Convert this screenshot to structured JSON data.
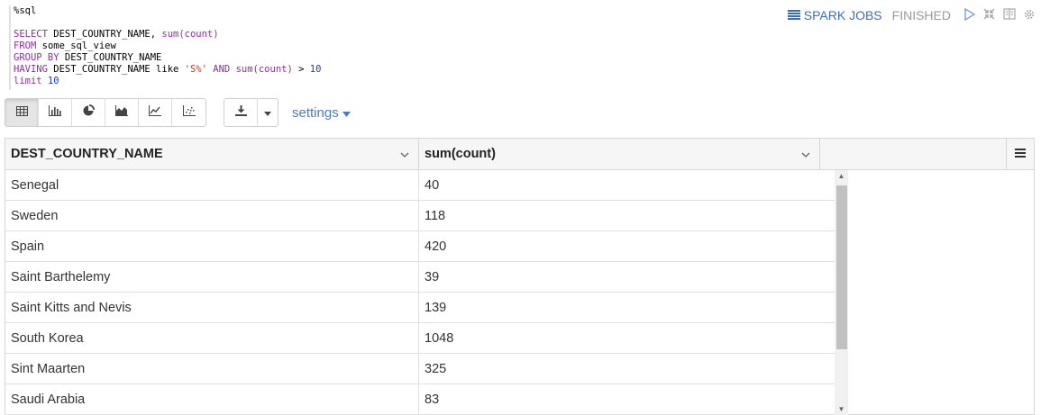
{
  "code": {
    "magic": "%sql",
    "l1_kw": "SELECT",
    "l1_rest": " DEST_COUNTRY_NAME, ",
    "l1_fn": "sum(count)",
    "l2_kw": "FROM",
    "l2_rest": " some_sql_view",
    "l3_kw": "GROUP BY",
    "l3_rest": " DEST_COUNTRY_NAME",
    "l4_kw": "HAVING",
    "l4_a": " DEST_COUNTRY_NAME like ",
    "l4_str": "'S%'",
    "l4_and": " AND ",
    "l4_fn": "sum(count)",
    "l4_op": " > ",
    "l4_num": "10",
    "l5_kw": "limit",
    "l5_num": " 10"
  },
  "status": {
    "spark_jobs": "SPARK JOBS",
    "state": "FINISHED"
  },
  "toolbar": {
    "settings_label": "settings"
  },
  "table": {
    "columns": [
      "DEST_COUNTRY_NAME",
      "sum(count)"
    ],
    "rows": [
      [
        "Senegal",
        "40"
      ],
      [
        "Sweden",
        "118"
      ],
      [
        "Spain",
        "420"
      ],
      [
        "Saint Barthelemy",
        "39"
      ],
      [
        "Saint Kitts and Nevis",
        "139"
      ],
      [
        "South Korea",
        "1048"
      ],
      [
        "Sint Maarten",
        "325"
      ],
      [
        "Saudi Arabia",
        "83"
      ]
    ]
  },
  "colors": {
    "accent": "#3a6fb6",
    "keyword": "#8e2e9c"
  }
}
